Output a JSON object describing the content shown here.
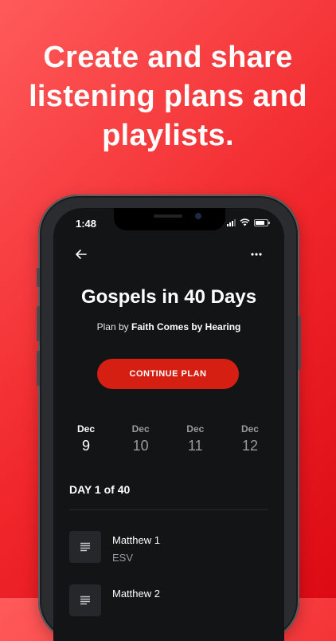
{
  "headline": {
    "line1": "Create and share",
    "line2": "listening plans and",
    "line3": "playlists."
  },
  "status_bar": {
    "time": "1:48"
  },
  "plan": {
    "title": "Gospels in 40 Days",
    "by_prefix": "Plan by",
    "by_author": "Faith Comes by Hearing",
    "continue_label": "CONTINUE PLAN"
  },
  "dates": [
    {
      "month": "Dec",
      "day": "9",
      "active": true
    },
    {
      "month": "Dec",
      "day": "10",
      "active": false
    },
    {
      "month": "Dec",
      "day": "11",
      "active": false
    },
    {
      "month": "Dec",
      "day": "12",
      "active": false
    }
  ],
  "day_header": "DAY 1 of 40",
  "readings": [
    {
      "title": "Matthew 1",
      "version": "ESV",
      "icon": "text-lines-icon"
    },
    {
      "title": "Matthew 2",
      "version": "",
      "icon": "text-lines-icon"
    }
  ],
  "colors": {
    "background_gradient": [
      "#ff5a5a",
      "#dc0a14"
    ],
    "accent": "#d51f12",
    "screen_bg": "#131416"
  }
}
